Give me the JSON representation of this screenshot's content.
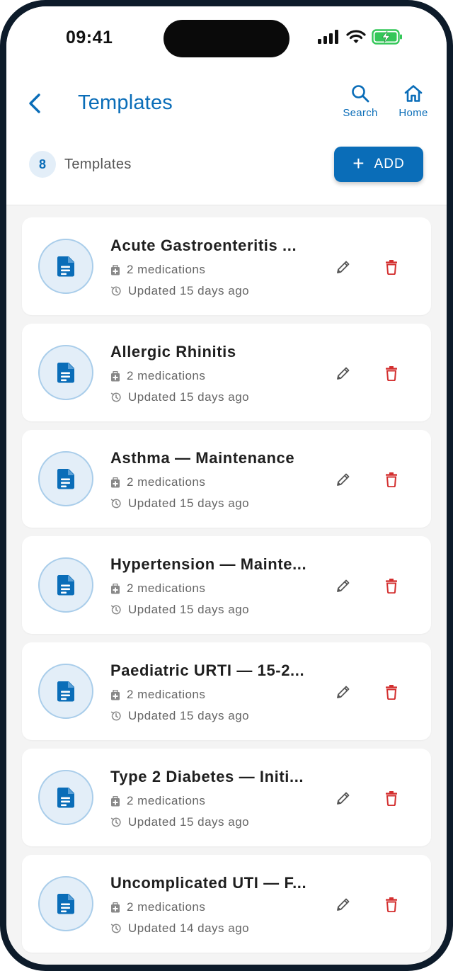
{
  "status": {
    "time": "09:41"
  },
  "header": {
    "title": "Templates",
    "search_label": "Search",
    "home_label": "Home"
  },
  "summary": {
    "count": "8",
    "count_label": "Templates",
    "add_label": "ADD"
  },
  "colors": {
    "primary": "#0a6db8",
    "danger": "#d32f2f",
    "background": "#f4f4f4",
    "battery": "#34c759"
  },
  "icons": {
    "back": "chevron-left-icon",
    "search": "search-icon",
    "home": "home-icon",
    "add": "plus-icon",
    "template": "document-icon",
    "medications": "medical-kit-icon",
    "updated": "history-icon",
    "edit": "pencil-icon",
    "delete": "trash-icon"
  },
  "templates": [
    {
      "title": "Acute Gastroenteritis ...",
      "medications": "2 medications",
      "updated": "Updated 15 days ago"
    },
    {
      "title": "Allergic Rhinitis",
      "medications": "2 medications",
      "updated": "Updated 15 days ago"
    },
    {
      "title": "Asthma — Maintenance",
      "medications": "2 medications",
      "updated": "Updated 15 days ago"
    },
    {
      "title": "Hypertension — Mainte...",
      "medications": "2 medications",
      "updated": "Updated 15 days ago"
    },
    {
      "title": "Paediatric URTI — 15-2...",
      "medications": "2 medications",
      "updated": "Updated 15 days ago"
    },
    {
      "title": "Type 2 Diabetes — Initi...",
      "medications": "2 medications",
      "updated": "Updated 15 days ago"
    },
    {
      "title": "Uncomplicated UTI — F...",
      "medications": "2 medications",
      "updated": "Updated 14 days ago"
    }
  ]
}
